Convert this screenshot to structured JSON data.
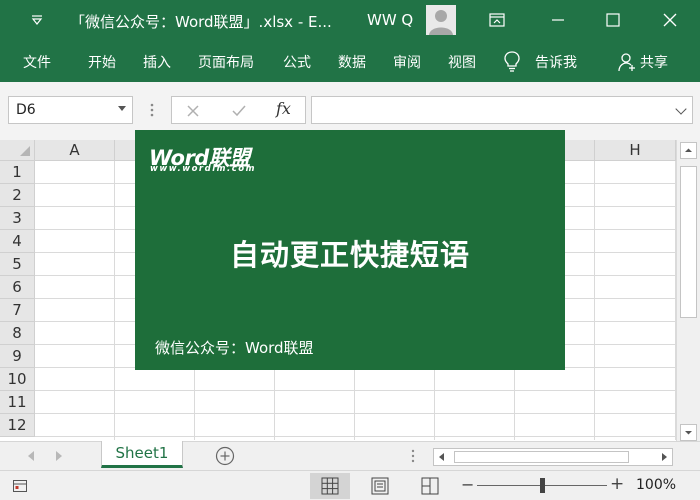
{
  "window": {
    "title": "「微信公众号：Word联盟」.xlsx  -  E...",
    "user": "WW Q"
  },
  "ribbon": {
    "tabs": [
      "文件",
      "开始",
      "插入",
      "页面布局",
      "公式",
      "数据",
      "审阅",
      "视图"
    ],
    "tell_me": "告诉我",
    "share": "共享"
  },
  "formula_bar": {
    "name_box": "D6",
    "fx_label": "fx",
    "formula": ""
  },
  "grid": {
    "column_headers": [
      "A",
      "",
      "",
      "",
      "",
      "",
      "",
      "H"
    ],
    "row_headers": [
      "1",
      "2",
      "3",
      "4",
      "5",
      "6",
      "7",
      "8",
      "9",
      "10",
      "11",
      "12"
    ]
  },
  "banner": {
    "logo_text": "Word联盟",
    "logo_url": "www.wordlm.com",
    "headline": "自动更正快捷短语",
    "footer": "微信公众号：Word联盟",
    "bg_color": "#1e6e3a"
  },
  "sheets": {
    "tabs": [
      "Sheet1"
    ],
    "active": "Sheet1"
  },
  "status_bar": {
    "zoom_level": "100%",
    "zoom_fraction": 0.5
  },
  "colors": {
    "accent": "#217346",
    "banner": "#1e6e3a"
  }
}
